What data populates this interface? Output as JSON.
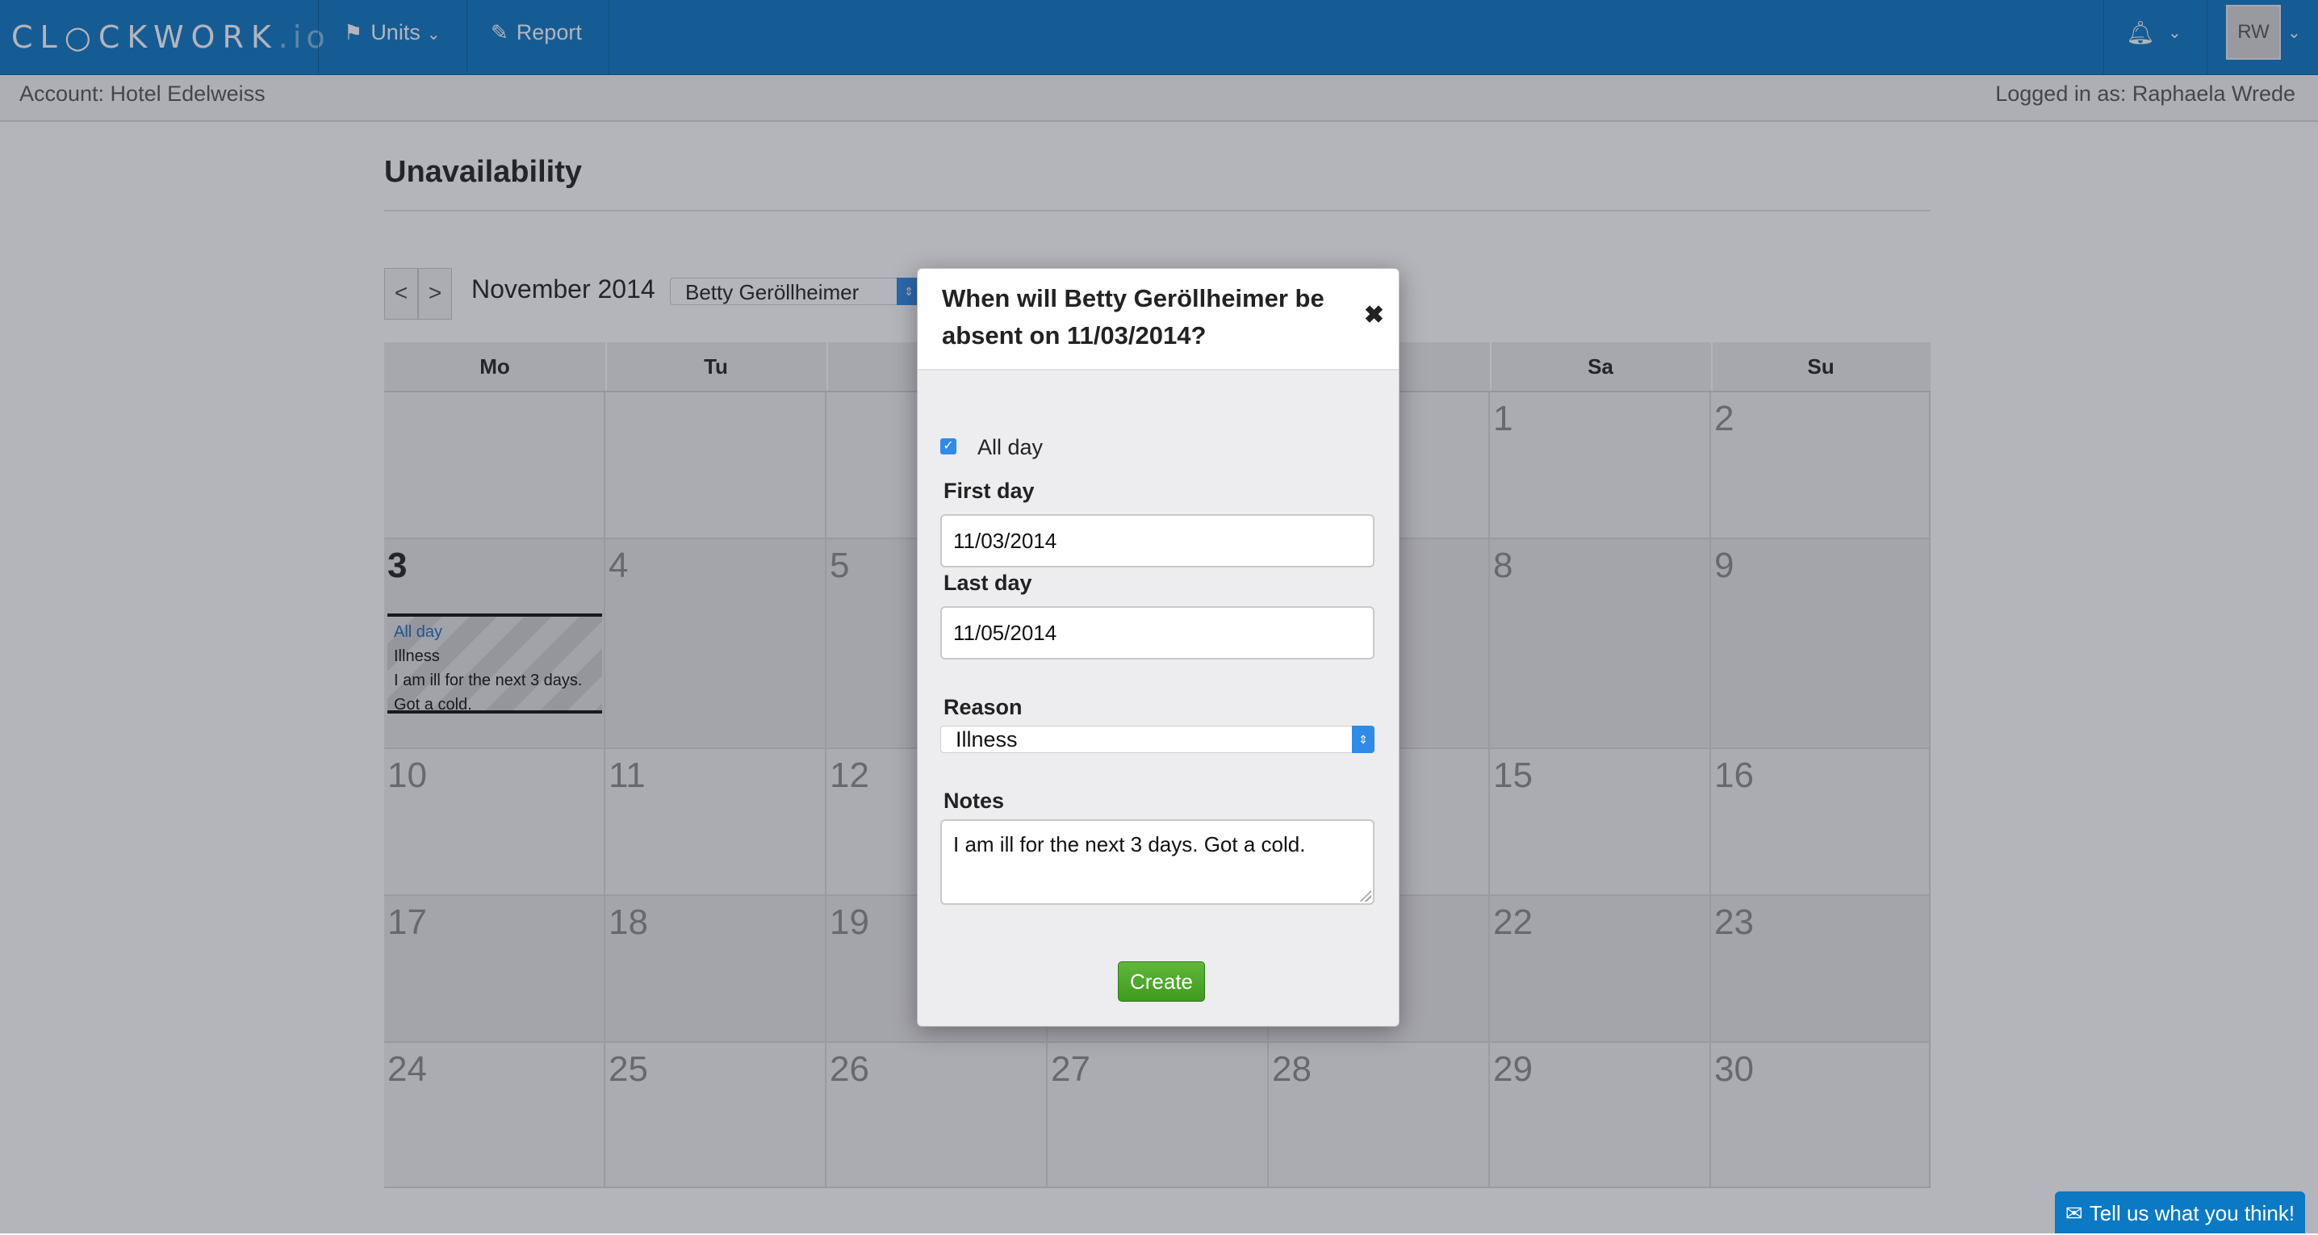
{
  "app": {
    "logo_text": "CL○CKWORK",
    "logo_suffix": ".io"
  },
  "topnav": {
    "units_label": "Units",
    "report_label": "Report",
    "avatar_initials": "RW"
  },
  "subbar": {
    "account": "Account: Hotel Edelweiss",
    "logged_in": "Logged in as: Raphaela Wrede"
  },
  "page": {
    "title": "Unavailability",
    "prev_label": "<",
    "next_label": ">",
    "month": "November 2014",
    "employee": "Betty Geröllheimer"
  },
  "calendar": {
    "weekdays": [
      "Mo",
      "Tu",
      "",
      "",
      "",
      "Sa",
      "Su"
    ],
    "days": {
      "d1": "1",
      "d2": "2",
      "d3": "3",
      "d4": "4",
      "d5": "5",
      "d8": "8",
      "d9": "9",
      "d10": "10",
      "d11": "11",
      "d12": "12",
      "d15": "15",
      "d16": "16",
      "d17": "17",
      "d18": "18",
      "d19": "19",
      "d22": "22",
      "d23": "23",
      "d24": "24",
      "d25": "25",
      "d26": "26",
      "d27": "27",
      "d28": "28",
      "d29": "29",
      "d30": "30"
    },
    "event": {
      "allday": "All day",
      "reason": "Illness",
      "note_line1": "I am ill for the next 3 days.",
      "note_line2": "Got a cold."
    }
  },
  "modal": {
    "title": "When will Betty Geröllheimer be absent on 11/03/2014?",
    "close": "✖",
    "allday_label": "All day",
    "allday_checked": true,
    "first_day_label": "First day",
    "first_day_value": "11/03/2014",
    "last_day_label": "Last day",
    "last_day_value": "11/05/2014",
    "reason_label": "Reason",
    "reason_value": "Illness",
    "notes_label": "Notes",
    "notes_value": "I am ill for the next 3 days. Got a cold.",
    "create_label": "Create"
  },
  "feedback": {
    "label": "Tell us what you think!"
  },
  "colors": {
    "brand": "#0b79c3",
    "accent": "#2e8be8",
    "create": "#4aa828"
  }
}
